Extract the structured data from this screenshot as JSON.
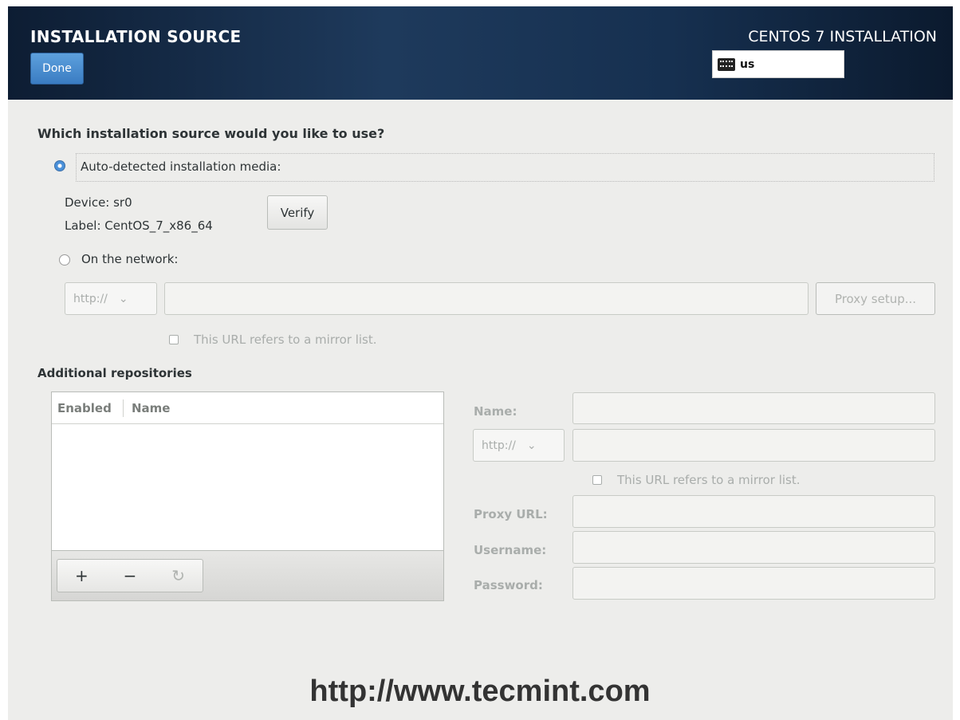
{
  "header": {
    "title": "INSTALLATION SOURCE",
    "done_label": "Done",
    "product": "CENTOS 7 INSTALLATION",
    "keyboard_layout": "us",
    "keyboard_icon": "keyboard-icon"
  },
  "source": {
    "question": "Which installation source would you like to use?",
    "auto_label": "Auto-detected installation media:",
    "device": "Device: sr0",
    "label": "Label: CentOS_7_x86_64",
    "verify_label": "Verify",
    "network_label": "On the network:",
    "protocol": "http://",
    "url_value": "",
    "proxy_label": "Proxy setup...",
    "mirror_label": "This URL refers to a mirror list.",
    "selected": "auto"
  },
  "repos": {
    "heading": "Additional repositories",
    "columns": [
      "Enabled",
      "Name"
    ],
    "add": "+",
    "remove": "−",
    "reset": "↻"
  },
  "repo_form": {
    "name_label": "Name:",
    "protocol": "http://",
    "mirror_label": "This URL refers to a mirror list.",
    "proxy_url_label": "Proxy URL:",
    "username_label": "Username:",
    "password_label": "Password:"
  },
  "watermark": "http://www.tecmint.com",
  "colors": {
    "accent": "#4a90d9",
    "header_bg": "#132a46",
    "background": "#ededeb"
  }
}
